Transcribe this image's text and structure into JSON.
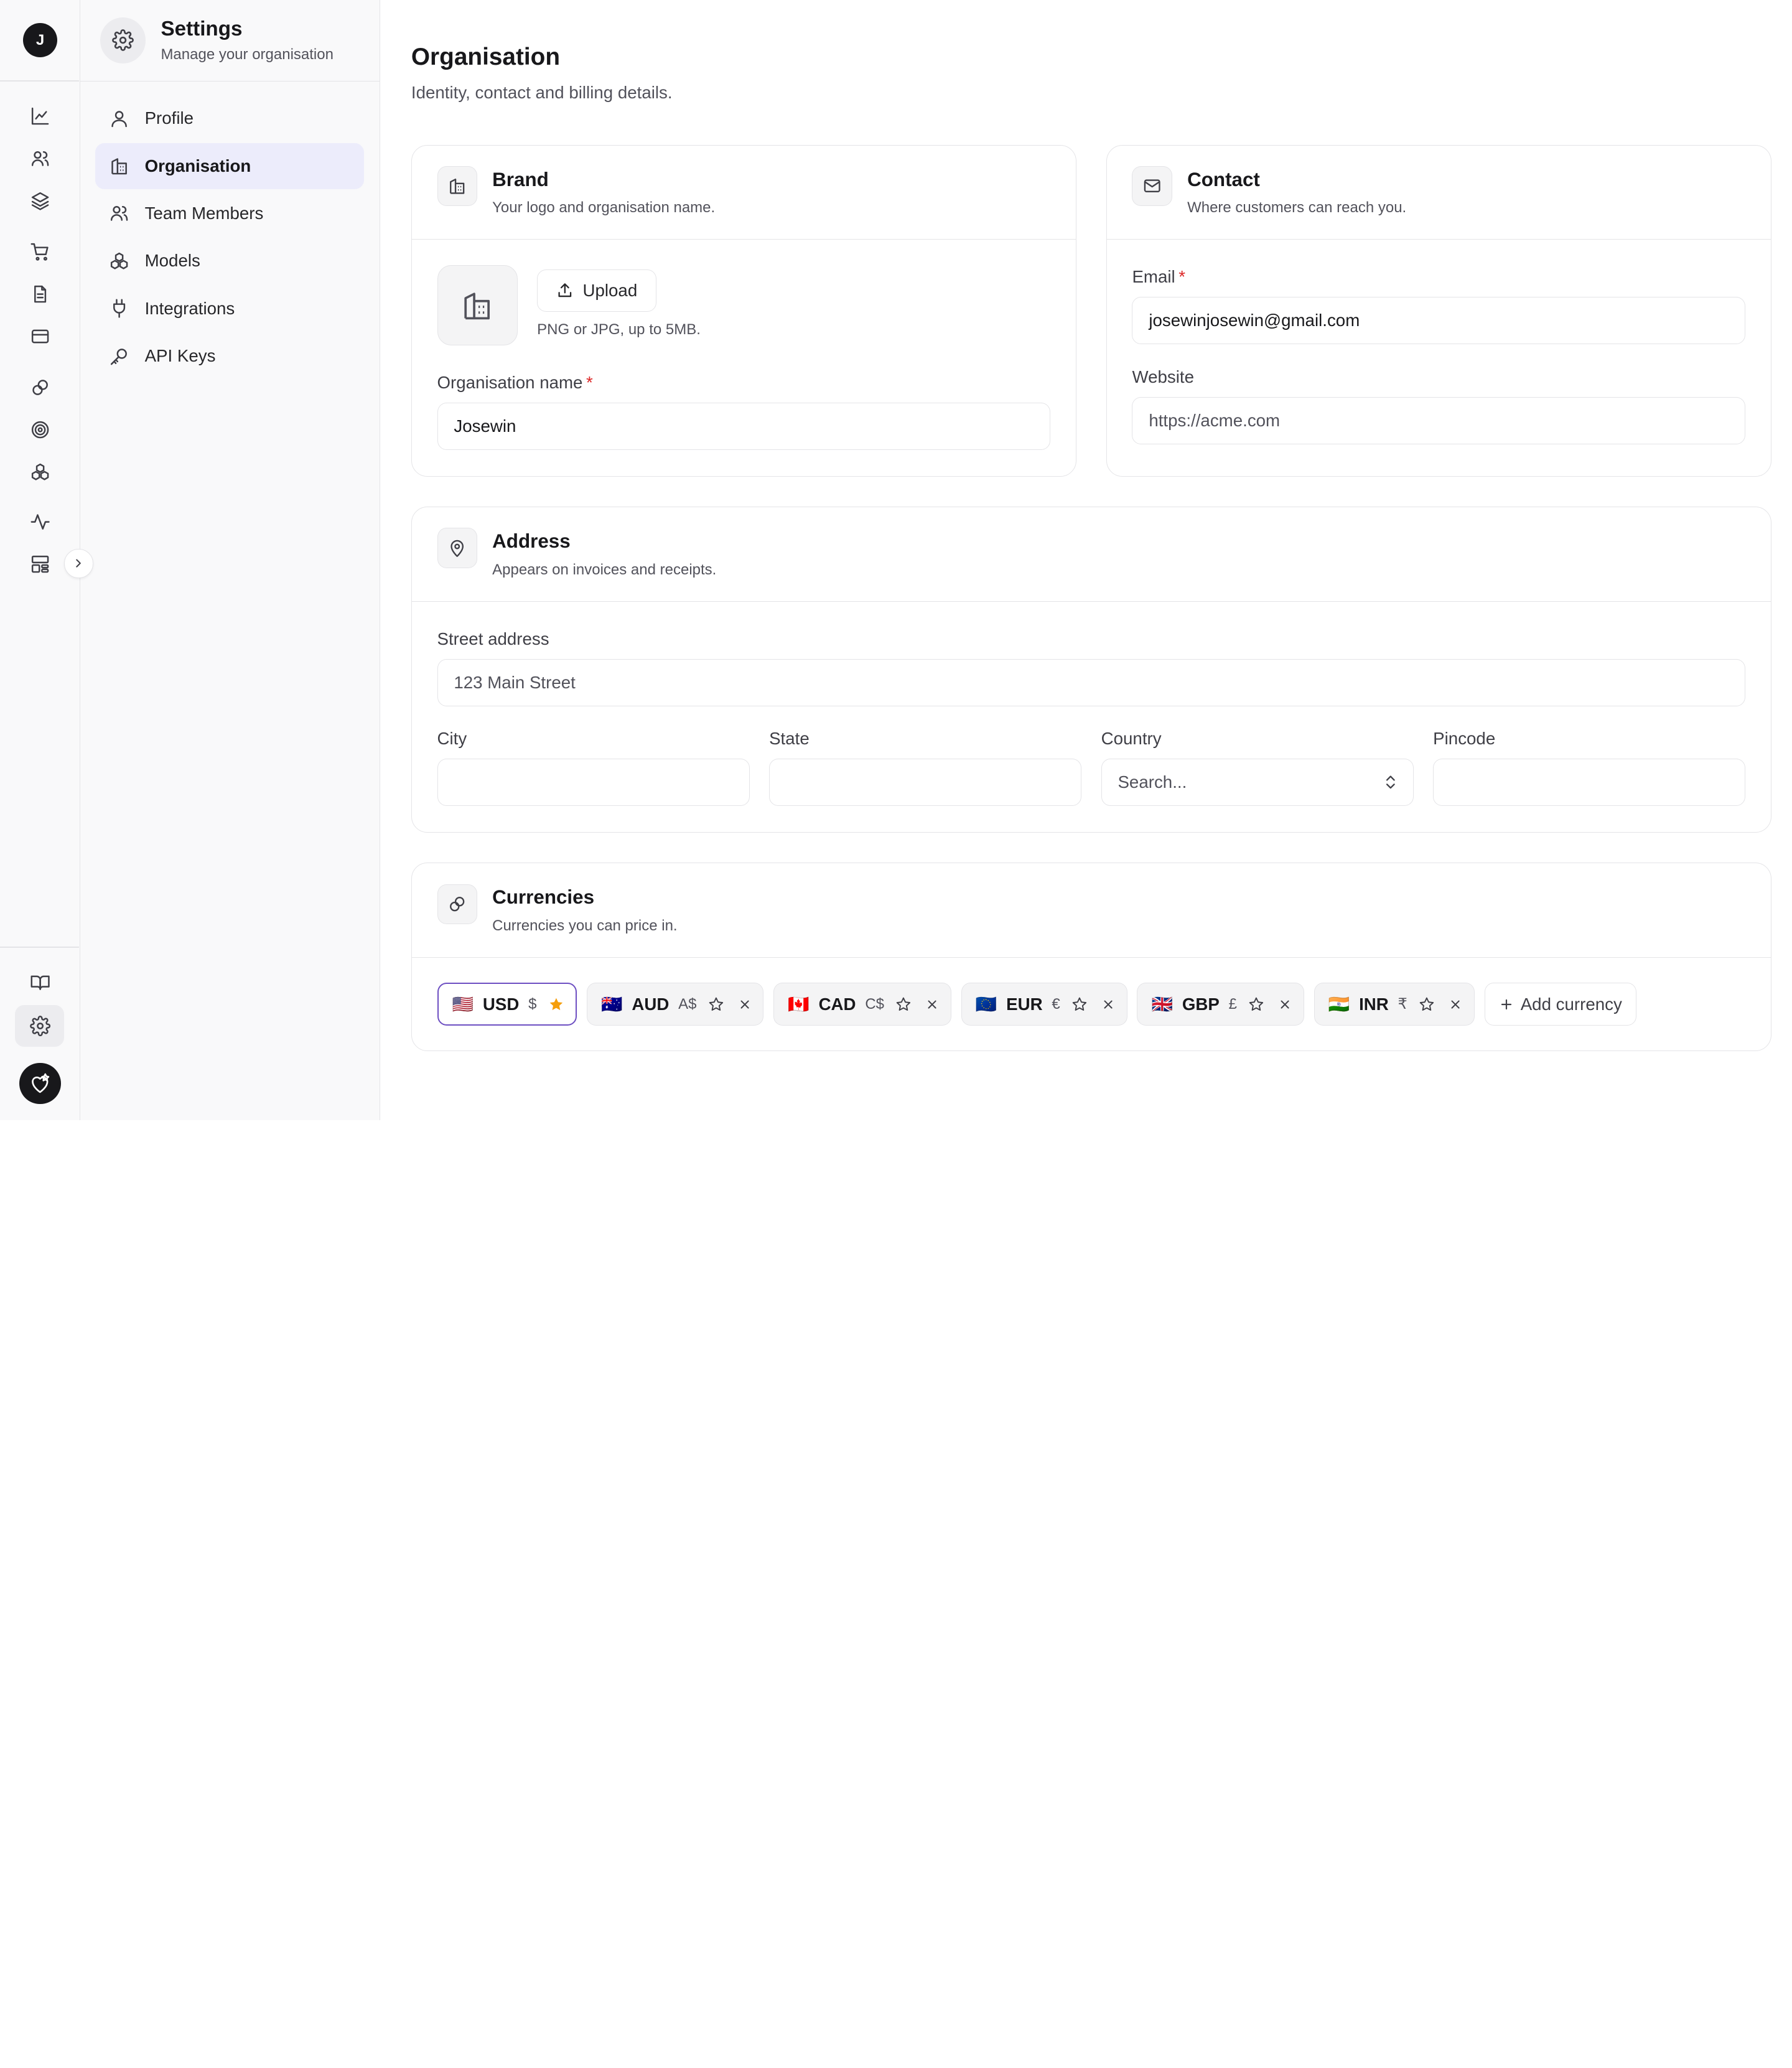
{
  "rail": {
    "avatar_initial": "J"
  },
  "sidebar": {
    "title": "Settings",
    "subtitle": "Manage your organisation",
    "items": [
      {
        "label": "Profile"
      },
      {
        "label": "Organisation"
      },
      {
        "label": "Team Members"
      },
      {
        "label": "Models"
      },
      {
        "label": "Integrations"
      },
      {
        "label": "API Keys"
      }
    ]
  },
  "page": {
    "title": "Organisation",
    "subtitle": "Identity, contact and billing details."
  },
  "brand": {
    "title": "Brand",
    "subtitle": "Your logo and organisation name.",
    "upload_label": "Upload",
    "upload_hint": "PNG or JPG, up to 5MB.",
    "name_label": "Organisation name",
    "name_value": "Josewin"
  },
  "contact": {
    "title": "Contact",
    "subtitle": "Where customers can reach you.",
    "email_label": "Email",
    "email_value": "josewinjosewin@gmail.com",
    "website_label": "Website",
    "website_placeholder": "https://acme.com"
  },
  "address": {
    "title": "Address",
    "subtitle": "Appears on invoices and receipts.",
    "street_label": "Street address",
    "street_placeholder": "123 Main Street",
    "city_label": "City",
    "state_label": "State",
    "country_label": "Country",
    "country_placeholder": "Search...",
    "pincode_label": "Pincode"
  },
  "currencies": {
    "title": "Currencies",
    "subtitle": "Currencies you can price in.",
    "items": [
      {
        "flag": "🇺🇸",
        "code": "USD",
        "symbol": "$"
      },
      {
        "flag": "🇦🇺",
        "code": "AUD",
        "symbol": "A$"
      },
      {
        "flag": "🇨🇦",
        "code": "CAD",
        "symbol": "C$"
      },
      {
        "flag": "🇪🇺",
        "code": "EUR",
        "symbol": "€"
      },
      {
        "flag": "🇬🇧",
        "code": "GBP",
        "symbol": "£"
      },
      {
        "flag": "🇮🇳",
        "code": "INR",
        "symbol": "₹"
      }
    ],
    "add_label": "Add currency"
  },
  "colors": {
    "accent": "#6d4fc2",
    "active_nav_bg": "#ececfb",
    "required": "#dc2626",
    "star_primary": "#f59e0b"
  }
}
